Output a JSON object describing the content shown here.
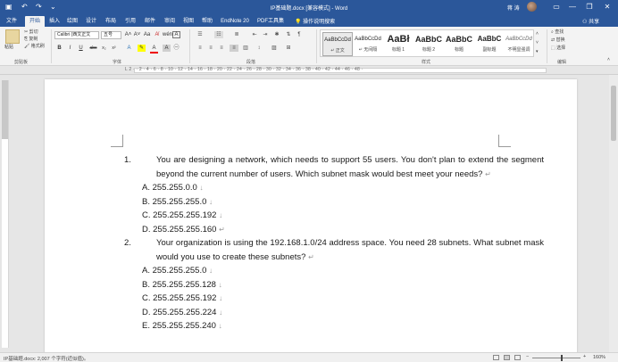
{
  "titlebar": {
    "title": "IP基础题.docx [兼容模式] - Word",
    "user": "蒋 涛",
    "save_icon": "▣",
    "undo_icon": "↶",
    "redo_icon": "↷",
    "customize_icon": "⌄",
    "ribbon_opts_icon": "▭",
    "minimize_icon": "—",
    "restore_icon": "❐",
    "close_icon": "✕"
  },
  "tabs": [
    {
      "label": "文件",
      "active": false
    },
    {
      "label": "开始",
      "active": true
    },
    {
      "label": "插入",
      "active": false
    },
    {
      "label": "绘图",
      "active": false
    },
    {
      "label": "设计",
      "active": false
    },
    {
      "label": "布局",
      "active": false
    },
    {
      "label": "引用",
      "active": false
    },
    {
      "label": "邮件",
      "active": false
    },
    {
      "label": "审阅",
      "active": false
    },
    {
      "label": "视图",
      "active": false
    },
    {
      "label": "帮助",
      "active": false
    },
    {
      "label": "EndNote 20",
      "active": false
    },
    {
      "label": "PDF工具集",
      "active": false
    }
  ],
  "tell_me": "操作说明搜索",
  "share": "共享",
  "ribbon": {
    "clipboard": {
      "paste": "粘贴",
      "cut": "剪切",
      "copy": "复制",
      "format_painter": "格式刷",
      "label": "剪贴板"
    },
    "font": {
      "name": "Calibri (西文正文",
      "size": "五号",
      "grow_icon": "A˄",
      "shrink_icon": "A˅",
      "case_icon": "Aa",
      "clear_icon": "A̸",
      "phonetic_icon": "wén",
      "border_char_icon": "A",
      "bold": "B",
      "italic": "I",
      "underline": "U",
      "strike": "abc",
      "sub": "x₂",
      "sup": "x²",
      "effects": "A",
      "highlight": "✎",
      "color": "A",
      "shade": "A",
      "circle": "㊀",
      "label": "字体"
    },
    "paragraph": {
      "label": "段落"
    },
    "styles": {
      "label": "样式",
      "items": [
        {
          "preview": "AaBbCcDd",
          "name": "↵ 正文",
          "selected": true
        },
        {
          "preview": "AaBbCcDd",
          "name": "↵ 无间隔",
          "selected": false
        },
        {
          "preview": "AaBł",
          "name": "标题 1",
          "selected": false
        },
        {
          "preview": "AaBbC",
          "name": "标题 2",
          "selected": false
        },
        {
          "preview": "AaBbC",
          "name": "标题",
          "selected": false
        },
        {
          "preview": "AaBbC",
          "name": "副标题",
          "selected": false
        },
        {
          "preview": "AaBbCcDd",
          "name": "不明显强调",
          "selected": false
        }
      ]
    },
    "editing": {
      "find": "查找",
      "replace": "替换",
      "select": "选择",
      "label": "编辑"
    }
  },
  "ruler": {
    "numbers": "L  2 · · 2 · 4 · 6 · 8 · 10 · 12 · 14 · 16 · 18 · 20 · 22 · 24 · 26 · 28 · 30 · 32 · 34 · 36 · 38 · 40 · 42 · 44 · 46 · 48 ·"
  },
  "document": {
    "questions": [
      {
        "num": "1.",
        "text": "You are designing a network, which needs to support 55 users. You don't plan to extend the segment beyond the current number of users. Which subnet mask would best meet your needs?",
        "mark": "↵",
        "options": [
          {
            "text": "A. 255.255.0.0",
            "mark": "↓"
          },
          {
            "text": "B. 255.255.255.0",
            "mark": "↓"
          },
          {
            "text": "C. 255.255.255.192",
            "mark": "↓"
          },
          {
            "text": "D. 255.255.255.160",
            "mark": "↵"
          }
        ]
      },
      {
        "num": "2.",
        "text": "Your organization is using the 192.168.1.0/24 address space. You need 28 subnets. What subnet mask would you use to create these subnets?",
        "mark": "↵",
        "options": [
          {
            "text": "A. 255.255.255.0",
            "mark": "↓"
          },
          {
            "text": "B. 255.255.255.128",
            "mark": "↓"
          },
          {
            "text": "C. 255.255.255.192",
            "mark": "↓"
          },
          {
            "text": "D. 255.255.255.224",
            "mark": "↓"
          },
          {
            "text": "E. 255.255.255.240",
            "mark": "↓"
          }
        ]
      }
    ]
  },
  "status": {
    "left": "IP基础题.docx: 2,007 个字符(近似值)。",
    "zoom": "160%",
    "zoom_level": 0.62,
    "minus": "−",
    "plus": "+"
  }
}
